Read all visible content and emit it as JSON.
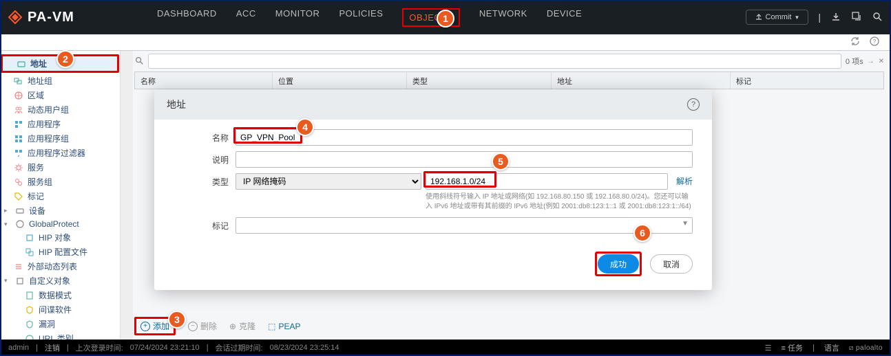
{
  "brand": "PA-VM",
  "nav": {
    "dashboard": "DASHBOARD",
    "acc": "ACC",
    "monitor": "MONITOR",
    "policies": "POLICIES",
    "objects": "OBJECTS",
    "network": "NETWORK",
    "device": "DEVICE"
  },
  "commit_label": "Commit",
  "search": {
    "placeholder": "",
    "count": "0 项s"
  },
  "table": {
    "col_name": "名称",
    "col_location": "位置",
    "col_type": "类型",
    "col_address": "地址",
    "col_tag": "标记"
  },
  "sidebar": {
    "address": "地址",
    "address_group": "地址组",
    "region": "区域",
    "dynamic_user_group": "动态用户组",
    "application": "应用程序",
    "application_group": "应用程序组",
    "application_filter": "应用程序过滤器",
    "service": "服务",
    "service_group": "服务组",
    "tag": "标记",
    "device": "设备",
    "globalprotect": "GlobalProtect",
    "hip_object": "HIP 对象",
    "hip_profile": "HIP 配置文件",
    "external_dynamic_list": "外部动态列表",
    "custom_object": "自定义对象",
    "data_pattern": "数据模式",
    "spyware": "间谍软件",
    "vulnerability": "漏洞",
    "url_category": "URL 类别"
  },
  "actions": {
    "add": "添加",
    "delete": "删除",
    "clone": "克隆",
    "peap": "PEAP"
  },
  "modal": {
    "title": "地址",
    "label_name": "名称",
    "label_desc": "说明",
    "label_type": "类型",
    "label_tag": "标记",
    "value_name": "GP_VPN_Pool",
    "type_option": "IP 网络掩码",
    "value_ip": "192.168.1.0/24",
    "resolve": "解析",
    "hint": "使用斜线符号输入 IP 地址或网络(如 192.168.80.150 或 192.168.80.0/24)。您还可以输入 IPv6 地址或带有其前缀的 IPv6 地址(例如 2001:db8:123:1::1 或 2001:db8:123:1::/64)",
    "ok": "成功",
    "cancel": "取消"
  },
  "status": {
    "admin": "admin",
    "logout": "注销",
    "last_login_label": "上次登录时间:",
    "last_login": "07/24/2024 23:21:10",
    "session_label": "会话过期时间:",
    "session": "08/23/2024 23:25:14",
    "tasks": "任务",
    "lang": "语言",
    "brand": "paloalto"
  }
}
